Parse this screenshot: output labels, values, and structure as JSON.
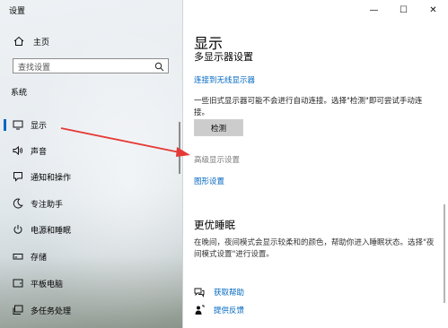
{
  "window": {
    "title": "设置",
    "minimize": "—",
    "maximize": "☐",
    "close": "✕"
  },
  "sidebar": {
    "home_label": "主页",
    "search_placeholder": "查找设置",
    "section_label": "系统",
    "items": [
      {
        "label": "显示",
        "icon": "monitor-icon",
        "selected": true
      },
      {
        "label": "声音",
        "icon": "speaker-icon"
      },
      {
        "label": "通知和操作",
        "icon": "notification-icon"
      },
      {
        "label": "专注助手",
        "icon": "moon-icon"
      },
      {
        "label": "电源和睡眠",
        "icon": "power-icon"
      },
      {
        "label": "存储",
        "icon": "storage-icon"
      },
      {
        "label": "平板电脑",
        "icon": "tablet-icon"
      },
      {
        "label": "多任务处理",
        "icon": "multitask-icon"
      }
    ]
  },
  "main": {
    "page_title": "显示",
    "subheading": "多显示器设置",
    "wireless_link": "连接到无线显示器",
    "detect_description": "一些旧式显示器可能不会进行自动连接。选择\"检测\"即可尝试手动连接。",
    "detect_button": "检测",
    "advanced_display": "高级显示设置",
    "graphics_link": "图形设置",
    "sleep_heading": "更优睡眠",
    "sleep_description": "在晚间，夜间模式会显示较柔和的颜色，帮助你进入睡眠状态。选择\"夜间模式设置\"进行设置。",
    "help_link": "获取帮助",
    "feedback_link": "提供反馈"
  },
  "colors": {
    "accent": "#0067c0",
    "annotation_arrow": "#e53935"
  }
}
